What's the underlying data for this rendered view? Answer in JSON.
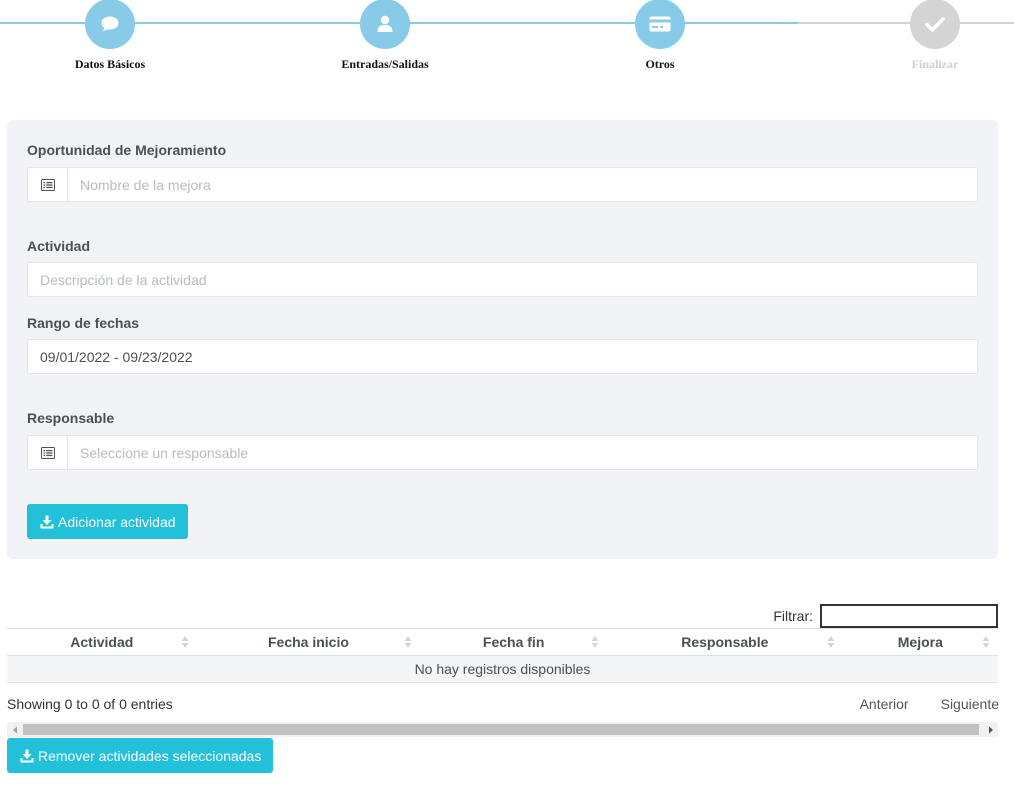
{
  "wizard": {
    "steps": [
      {
        "label": "Datos Básicos",
        "icon": "comment-icon",
        "state": "active"
      },
      {
        "label": "Entradas/Salidas",
        "icon": "user-icon",
        "state": "active"
      },
      {
        "label": "Otros",
        "icon": "credit-card-icon",
        "state": "active"
      },
      {
        "label": "Finalizar",
        "icon": "check-icon",
        "state": "disabled"
      }
    ]
  },
  "form": {
    "mejora": {
      "label": "Oportunidad de Mejoramiento",
      "placeholder": "Nombre de la mejora",
      "value": ""
    },
    "actividad": {
      "label": "Actividad",
      "placeholder": "Descripción de la actividad",
      "value": ""
    },
    "fechas": {
      "label": "Rango de fechas",
      "value": "09/01/2022 - 09/23/2022"
    },
    "responsable": {
      "label": "Responsable",
      "placeholder": "Seleccione un responsable",
      "value": ""
    },
    "add_button": "Adicionar actividad"
  },
  "table": {
    "filter_label": "Filtrar:",
    "filter_value": "",
    "columns": [
      "Actividad",
      "Fecha inicio",
      "Fecha fin",
      "Responsable",
      "Mejora"
    ],
    "empty_message": "No hay registros disponibles",
    "info": "Showing 0 to 0 of 0 entries",
    "prev": "Anterior",
    "next": "Siguiente"
  },
  "remove_button": "Remover actividades seleccionadas",
  "colors": {
    "accent": "#23c0d9",
    "step_active": "#87cbe8",
    "step_disabled": "#d4d4d4",
    "panel_bg": "#f1f3f7"
  }
}
